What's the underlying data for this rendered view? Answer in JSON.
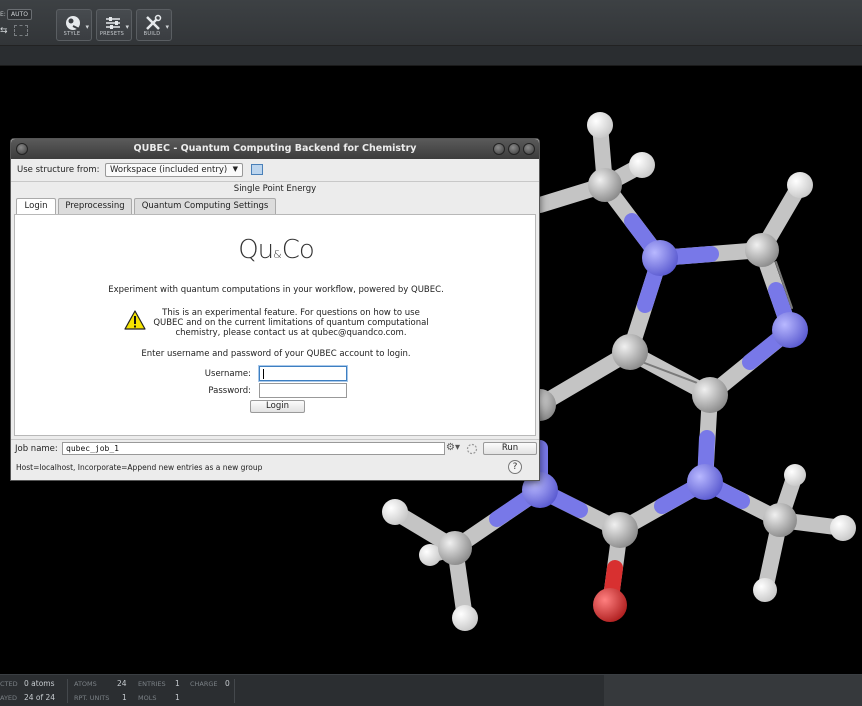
{
  "toolbar": {
    "auto_label": "AUTO",
    "buttons": [
      {
        "label": "STYLE",
        "icon": "style-icon"
      },
      {
        "label": "PRESETS",
        "icon": "presets-icon"
      },
      {
        "label": "BUILD",
        "icon": "build-icon"
      }
    ]
  },
  "dialog": {
    "title": "QUBEC - Quantum Computing Backend for Chemistry",
    "use_structure_label": "Use structure from:",
    "use_structure_value": "Workspace (included entry)",
    "task_title": "Single Point Energy",
    "tabs": [
      "Login",
      "Preprocessing",
      "Quantum Computing Settings"
    ],
    "active_tab": "Login",
    "logo": {
      "left": "Qu",
      "amp": "&",
      "right": "Co"
    },
    "intro": "Experiment with quantum computations in your workflow, powered by QUBEC.",
    "warning": "This is an experimental feature. For questions on how to use QUBEC and on the current limitations of quantum computational chemistry, please contact us at qubec@quandco.com.",
    "enter_text": "Enter username and password of your QUBEC account to login.",
    "username_label": "Username:",
    "username_value": "",
    "password_label": "Password:",
    "password_value": "",
    "login_button": "Login",
    "job_name_label": "Job name:",
    "job_name_value": "qubec_job_1",
    "run_button": "Run",
    "host_text": "Host=localhost, Incorporate=Append new entries as a new group",
    "help": "?"
  },
  "statusbar": {
    "selected_label": "CTED",
    "selected_value": "0 atoms",
    "displayed_label": "AYED",
    "displayed_value": "24 of 24",
    "atoms_label": "ATOMS",
    "atoms_value": "24",
    "entries_label": "ENTRIES",
    "entries_value": "1",
    "charge_label": "CHARGE",
    "charge_value": "0",
    "rpt_label": "RPT. UNITS",
    "rpt_value": "1",
    "mols_label": "MOLS",
    "mols_value": "1"
  },
  "colors": {
    "carbon": "#b9b9b9",
    "nitrogen": "#7878e8",
    "oxygen": "#d83030",
    "hydrogen": "#f2f2f2"
  }
}
